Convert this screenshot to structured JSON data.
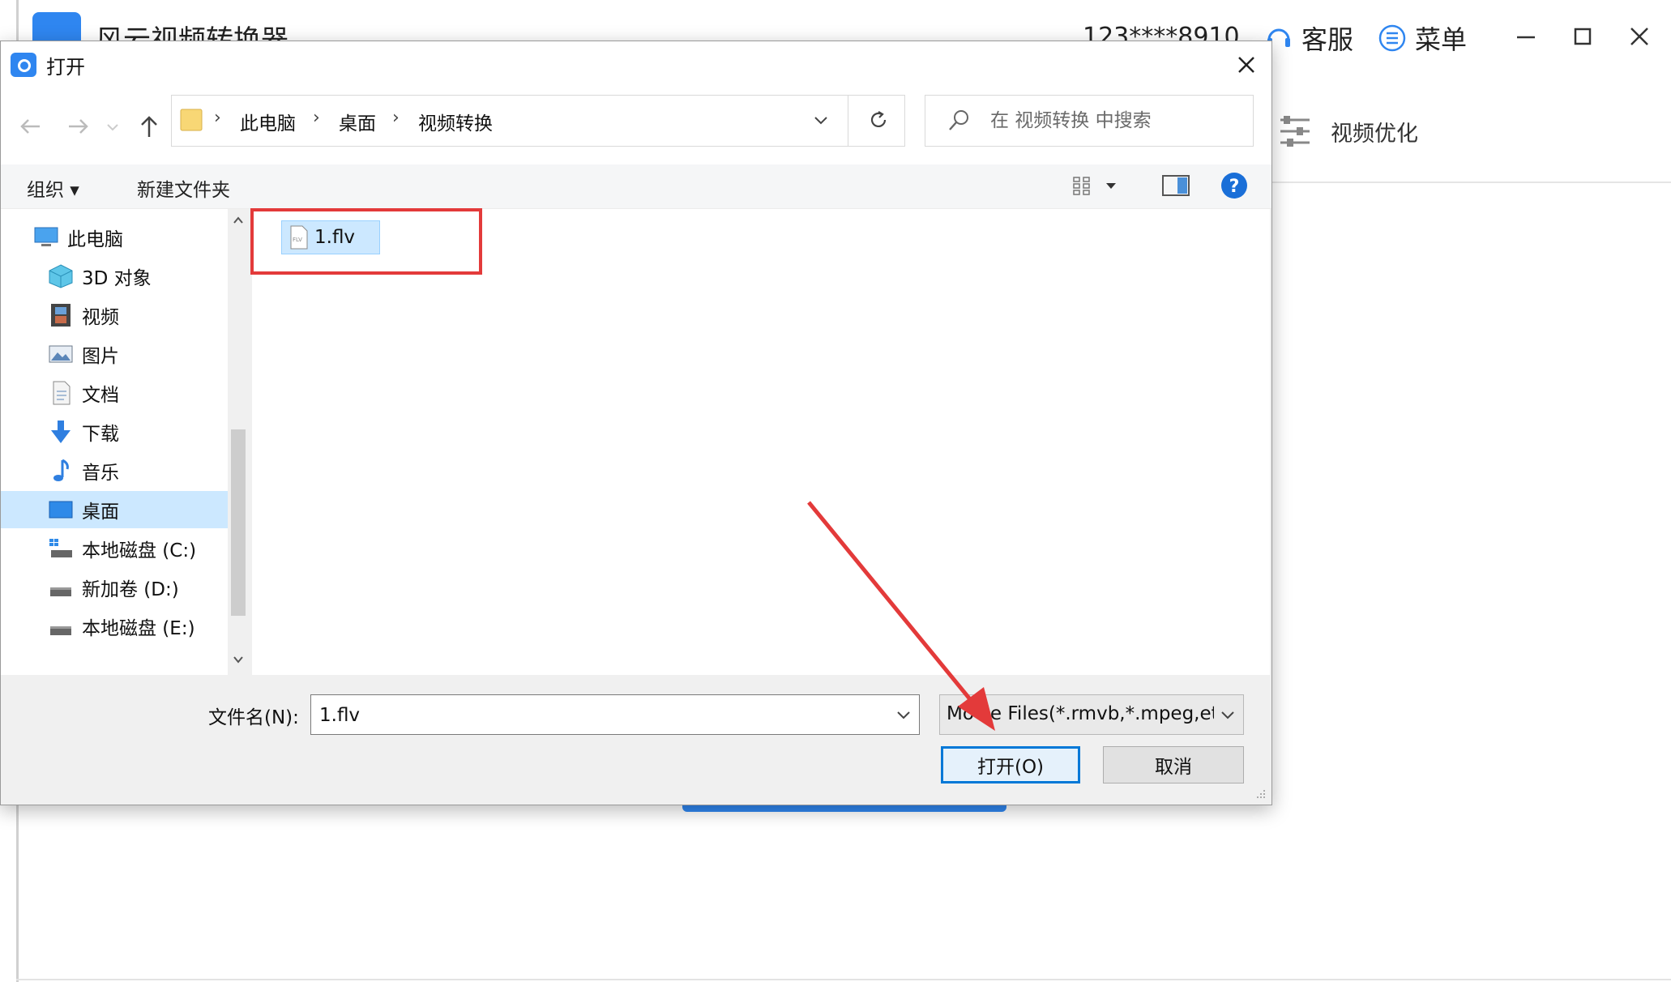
{
  "app": {
    "title": "风云视频转换器",
    "user": "123****8910",
    "service_label": "客服",
    "menu_label": "菜单",
    "optimize_label": "视频优化",
    "accent": "#2f86f0"
  },
  "dialog": {
    "title": "打开",
    "breadcrumb": [
      "此电脑",
      "桌面",
      "视频转换"
    ],
    "search_placeholder": "在 视频转换 中搜索",
    "toolbar": {
      "organize": "组织 ▾",
      "new_folder": "新建文件夹"
    },
    "nav_items": [
      {
        "label": "此电脑",
        "icon": "computer-icon"
      },
      {
        "label": "3D 对象",
        "icon": "cube-icon"
      },
      {
        "label": "视频",
        "icon": "film-icon"
      },
      {
        "label": "图片",
        "icon": "picture-icon"
      },
      {
        "label": "文档",
        "icon": "document-icon"
      },
      {
        "label": "下载",
        "icon": "download-icon"
      },
      {
        "label": "音乐",
        "icon": "music-icon"
      },
      {
        "label": "桌面",
        "icon": "desktop-icon",
        "selected": true
      },
      {
        "label": "本地磁盘 (C:)",
        "icon": "drive-icon"
      },
      {
        "label": "新加卷 (D:)",
        "icon": "drive-icon"
      },
      {
        "label": "本地磁盘 (E:)",
        "icon": "drive-icon"
      }
    ],
    "files": [
      {
        "name": "1.flv",
        "icon": "flv-file-icon",
        "selected": true
      }
    ],
    "filename_label": "文件名(N):",
    "filename_value": "1.flv",
    "filetype_value": "Movie Files(*.rmvb,*.mpeg,etc)",
    "open_label": "打开(O)",
    "cancel_label": "取消",
    "highlight_color": "#e33a3a"
  }
}
